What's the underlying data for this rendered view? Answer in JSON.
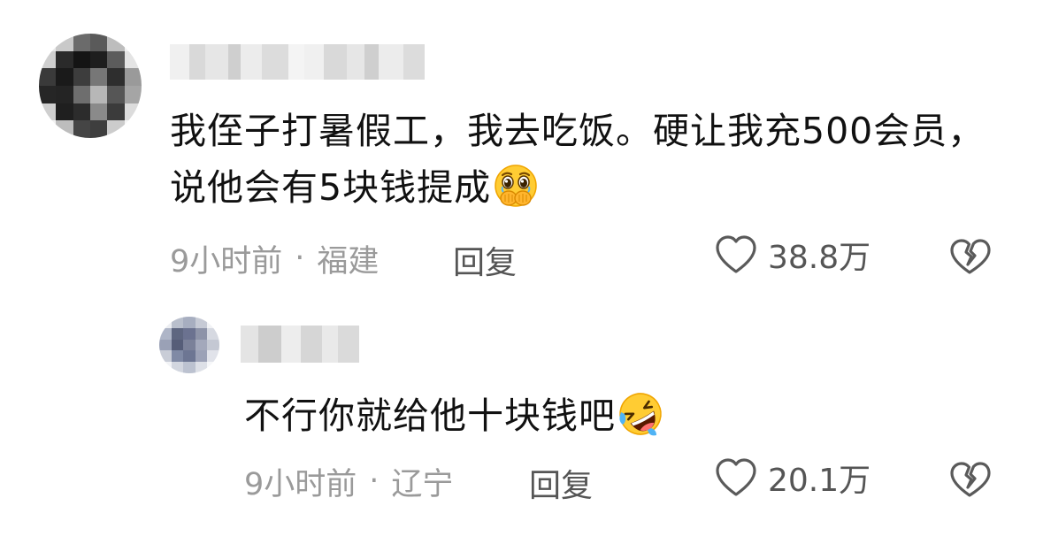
{
  "comments": [
    {
      "text": "我侄子打暑假工，我去吃饭。硬让我充500会员，说他会有5块钱提成",
      "emoji": "pleading-hands-over-mouth-emoji",
      "time": "9小时前",
      "separator": "·",
      "location": "福建",
      "reply_label": "回复",
      "likes": "38.8万"
    },
    {
      "text": "不行你就给他十块钱吧",
      "emoji": "rolling-on-floor-laughing-emoji",
      "time": "9小时前",
      "separator": "·",
      "location": "辽宁",
      "reply_label": "回复",
      "likes": "20.1万"
    }
  ],
  "icons": {
    "like": "heart-outline-icon",
    "dislike": "broken-heart-icon"
  },
  "colors": {
    "text": "#111111",
    "meta": "#9a9a9a",
    "action": "#555555",
    "icon": "#5a5a5a"
  }
}
